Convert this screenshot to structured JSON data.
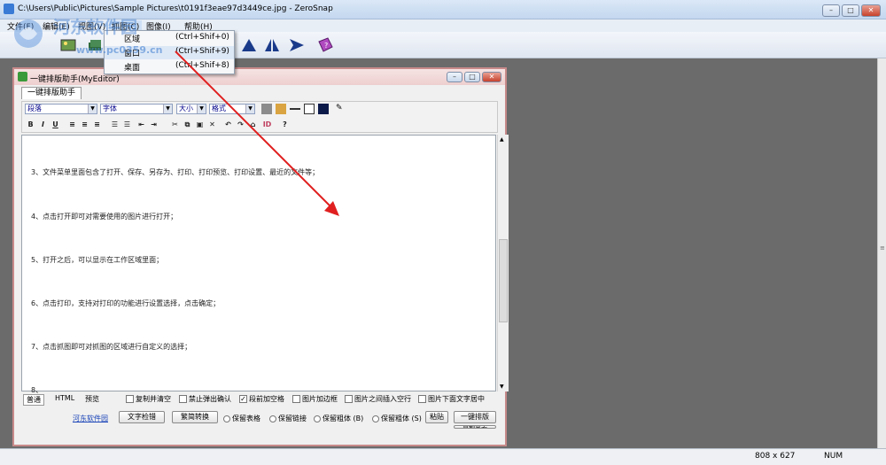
{
  "window": {
    "title": "C:\\Users\\Public\\Pictures\\Sample Pictures\\t0191f3eae97d3449ce.jpg - ZeroSnap",
    "min": "–",
    "max": "□",
    "close": "✕"
  },
  "menubar": {
    "items": [
      "文件(F)",
      "编辑(E)",
      "视图(V)",
      "抓图(C)",
      "图像(I)",
      "帮助(H)"
    ]
  },
  "dropdown": {
    "items": [
      {
        "label": "区域",
        "shortcut": "(Ctrl+Shif+0)"
      },
      {
        "label": "窗口",
        "shortcut": "(Ctrl+Shif+9)"
      },
      {
        "label": "桌面",
        "shortcut": "(Ctrl+Shif+8)"
      }
    ]
  },
  "watermark": {
    "text": "河东软件园",
    "url": "www.pc0359.cn"
  },
  "statusbar": {
    "size": "808 x 627",
    "num": "NUM"
  },
  "editor": {
    "title": "一键排版助手(MyEditor)",
    "tab": "一键排版助手",
    "selects": {
      "paragraph": "段落",
      "font": "字体",
      "size": "大小",
      "format": "格式"
    },
    "format_buttons": [
      "B",
      "I",
      "U"
    ],
    "lines": [
      "3、文件菜单里面包含了打开、保存、另存为、打印、打印预览、打印设置、最近的文件等；",
      "4、点击打开即可对需要使用的图片进行打开；",
      "5、打开之后，可以显示在工作区域里面；",
      "6、点击打印，支持对打印的功能进行设置选择，点击确定；",
      "7、点击抓图即可对抓图的区域进行自定义的选择；",
      "8、"
    ],
    "bottom_tabs": [
      "普通",
      "HTML",
      "预览"
    ],
    "checks": [
      {
        "label": "复制并清空",
        "checked": false
      },
      {
        "label": "禁止弹出确认",
        "checked": false
      },
      {
        "label": "段前加空格",
        "checked": true
      },
      {
        "label": "图片加边框",
        "checked": false
      },
      {
        "label": "图片之间插入空行",
        "checked": false
      },
      {
        "label": "图片下面文字居中",
        "checked": false
      }
    ],
    "link": "河东软件园",
    "buttons": {
      "check": "文字检错",
      "convert": "繁简转换",
      "paste": "粘贴",
      "format": "一键排版",
      "copy_out": "复制出去"
    },
    "radios": [
      "保留表格",
      "保留链接",
      "保留粗体 (B)",
      "保留粗体 (S)"
    ]
  }
}
